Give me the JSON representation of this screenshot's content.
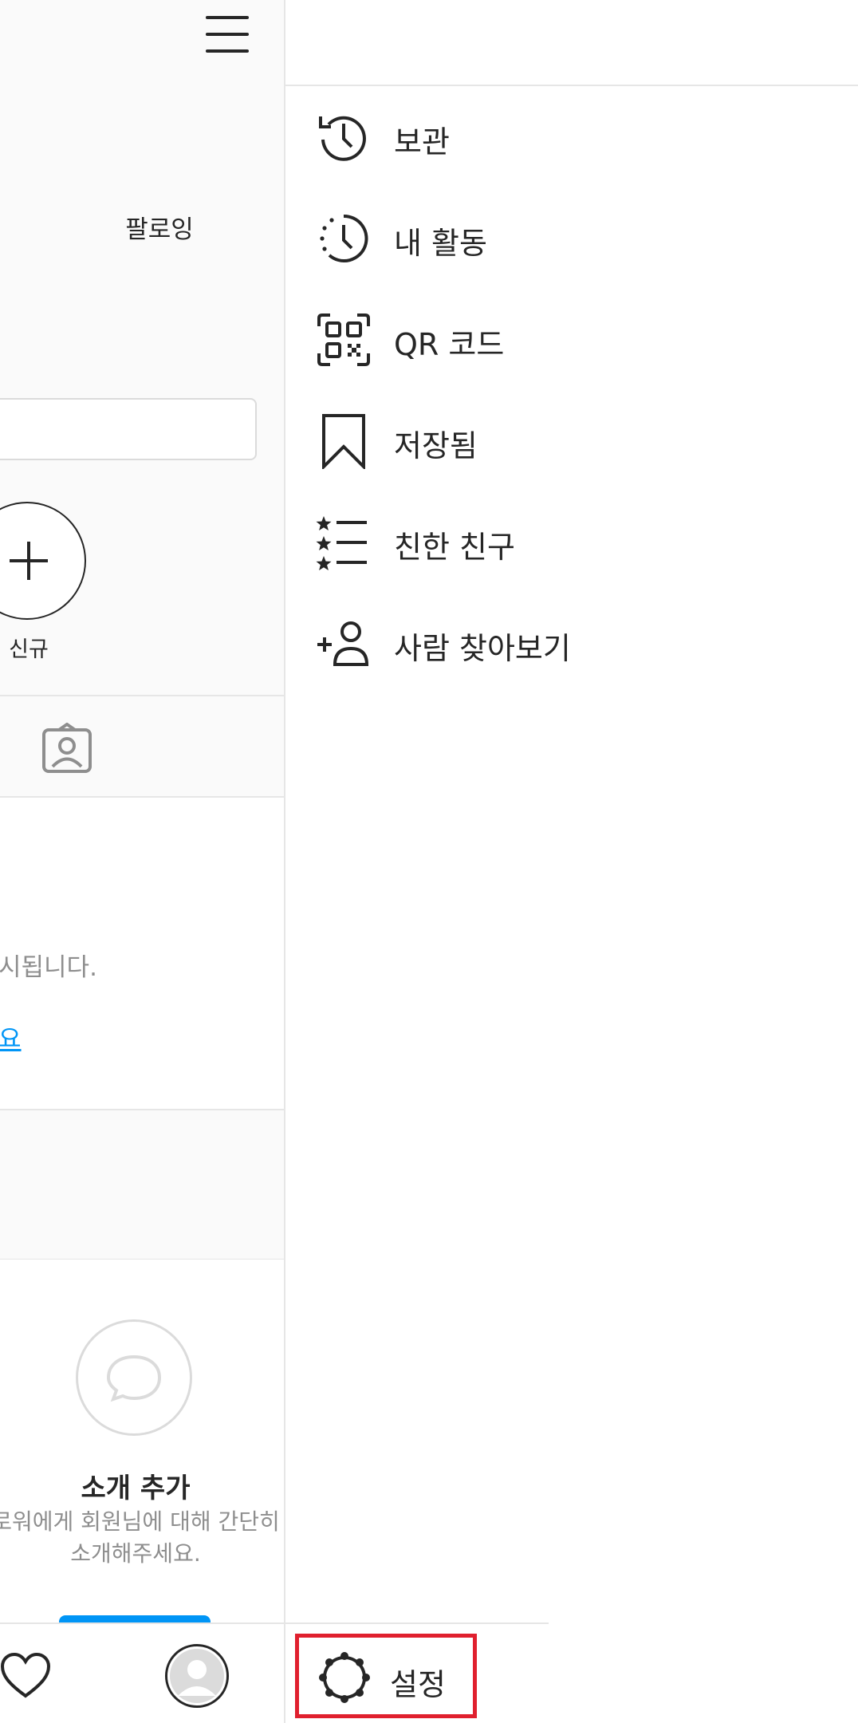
{
  "profile": {
    "following_label": "팔로잉",
    "new_highlight_label": "신규",
    "shown_text_fragment": "시됩니다.",
    "link_fragment": "요",
    "bio_title": "소개 추가",
    "bio_desc_line1": "로워에게 회원님에 대해 간단히",
    "bio_desc_line2": "소개해주세요."
  },
  "drawer": {
    "items": [
      {
        "label": "보관",
        "icon": "archive-icon"
      },
      {
        "label": "내 활동",
        "icon": "activity-icon"
      },
      {
        "label": "QR 코드",
        "icon": "qr-code-icon"
      },
      {
        "label": "저장됨",
        "icon": "bookmark-icon"
      },
      {
        "label": "친한 친구",
        "icon": "close-friends-icon"
      },
      {
        "label": "사람 찾아보기",
        "icon": "discover-people-icon"
      }
    ],
    "settings_label": "설정"
  },
  "colors": {
    "accent_blue": "#0095f6",
    "highlight_red": "#e0202e",
    "text": "#262626",
    "muted": "#8e8e8e"
  }
}
